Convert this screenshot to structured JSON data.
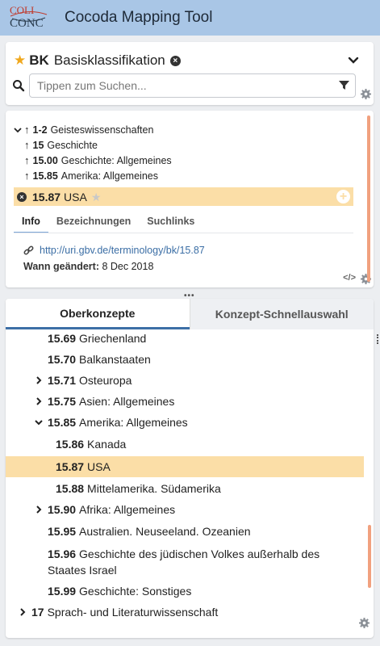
{
  "app": {
    "title": "Cocoda Mapping Tool",
    "logo_top": "COLI",
    "logo_bottom": "CONC"
  },
  "scheme": {
    "notation": "BK",
    "label": "Basisklassifikation"
  },
  "search": {
    "placeholder": "Tippen zum Suchen..."
  },
  "ancestors": [
    {
      "notation": "1-2",
      "label": "Geisteswissenschaften"
    },
    {
      "notation": "15",
      "label": "Geschichte"
    },
    {
      "notation": "15.00",
      "label": "Geschichte: Allgemeines"
    },
    {
      "notation": "15.85",
      "label": "Amerika: Allgemeines"
    }
  ],
  "selected": {
    "notation": "15.87",
    "label": "USA"
  },
  "detail_tabs": [
    "Info",
    "Bezeichnungen",
    "Suchlinks"
  ],
  "info": {
    "uri": "http://uri.gbv.de/terminology/bk/15.87",
    "changed_label": "Wann geändert:",
    "changed_value": "8 Dec 2018"
  },
  "browser_tabs": [
    "Oberkonzepte",
    "Konzept-Schnellauswahl"
  ],
  "tree": [
    {
      "notation": "15.69",
      "label": "Griechenland",
      "chevron": "none"
    },
    {
      "notation": "15.70",
      "label": "Balkanstaaten",
      "chevron": "none"
    },
    {
      "notation": "15.71",
      "label": "Osteuropa",
      "chevron": "right"
    },
    {
      "notation": "15.75",
      "label": "Asien: Allgemeines",
      "chevron": "right"
    },
    {
      "notation": "15.85",
      "label": "Amerika: Allgemeines",
      "chevron": "down"
    },
    {
      "notation": "15.86",
      "label": "Kanada",
      "chevron": "none"
    },
    {
      "notation": "15.87",
      "label": "USA",
      "chevron": "none",
      "selected": true
    },
    {
      "notation": "15.88",
      "label": "Mittelamerika. Südamerika",
      "chevron": "none"
    },
    {
      "notation": "15.90",
      "label": "Afrika: Allgemeines",
      "chevron": "right"
    },
    {
      "notation": "15.95",
      "label": "Australien. Neuseeland. Ozeanien",
      "chevron": "none"
    },
    {
      "notation": "15.96",
      "label": "Geschichte des jüdischen Volkes außerhalb des Staates Israel",
      "chevron": "none"
    },
    {
      "notation": "15.99",
      "label": "Geschichte: Sonstiges",
      "chevron": "none"
    },
    {
      "notation": "17",
      "label": "Sprach- und Literaturwissenschaft",
      "chevron": "right"
    }
  ],
  "colors": {
    "header": "#a9c6e6",
    "highlight": "#fbdea7",
    "accent": "#3d6fa6",
    "scrollbar": "#f1a17f",
    "star": "#f0a81e"
  },
  "icons": [
    "star-icon",
    "close-circle-icon",
    "chevron-down-icon",
    "search-icon",
    "filter-icon",
    "gear-icon",
    "arrow-up-icon",
    "plus-circle-icon",
    "link-icon",
    "code-icon",
    "chevron-right-icon"
  ]
}
